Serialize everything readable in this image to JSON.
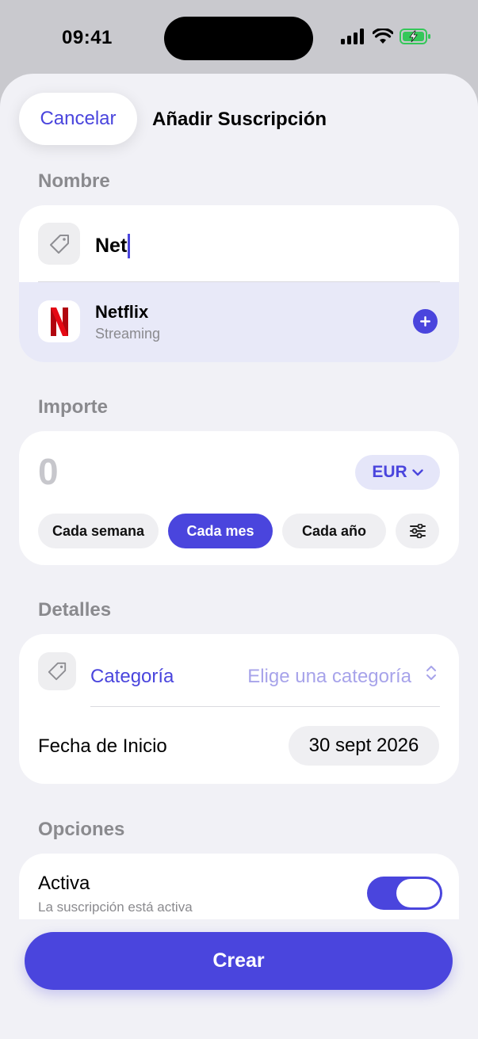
{
  "status_bar": {
    "time": "09:41"
  },
  "header": {
    "cancel_label": "Cancelar",
    "title": "Añadir Suscripción"
  },
  "name_section": {
    "label": "Nombre",
    "input_value": "Net",
    "tag_icon": "tag-icon",
    "suggestion": {
      "name": "Netflix",
      "category": "Streaming",
      "logo_letter": "N"
    }
  },
  "amount_section": {
    "label": "Importe",
    "amount": "0",
    "currency": "EUR",
    "frequencies": [
      "Cada semana",
      "Cada mes",
      "Cada año"
    ],
    "selected_frequency": "Cada mes"
  },
  "details_section": {
    "label": "Detalles",
    "category_label": "Categoría",
    "category_placeholder": "Elige una categoría",
    "start_date_label": "Fecha de Inicio",
    "start_date_value": "30 sept 2026"
  },
  "options_section": {
    "label": "Opciones",
    "active_title": "Activa",
    "active_subtitle": "La suscripción está activa",
    "active_on": true
  },
  "footer": {
    "create_label": "Crear"
  },
  "colors": {
    "accent": "#4a45dd",
    "netflix_red": "#e50914",
    "battery_green": "#34c759"
  }
}
